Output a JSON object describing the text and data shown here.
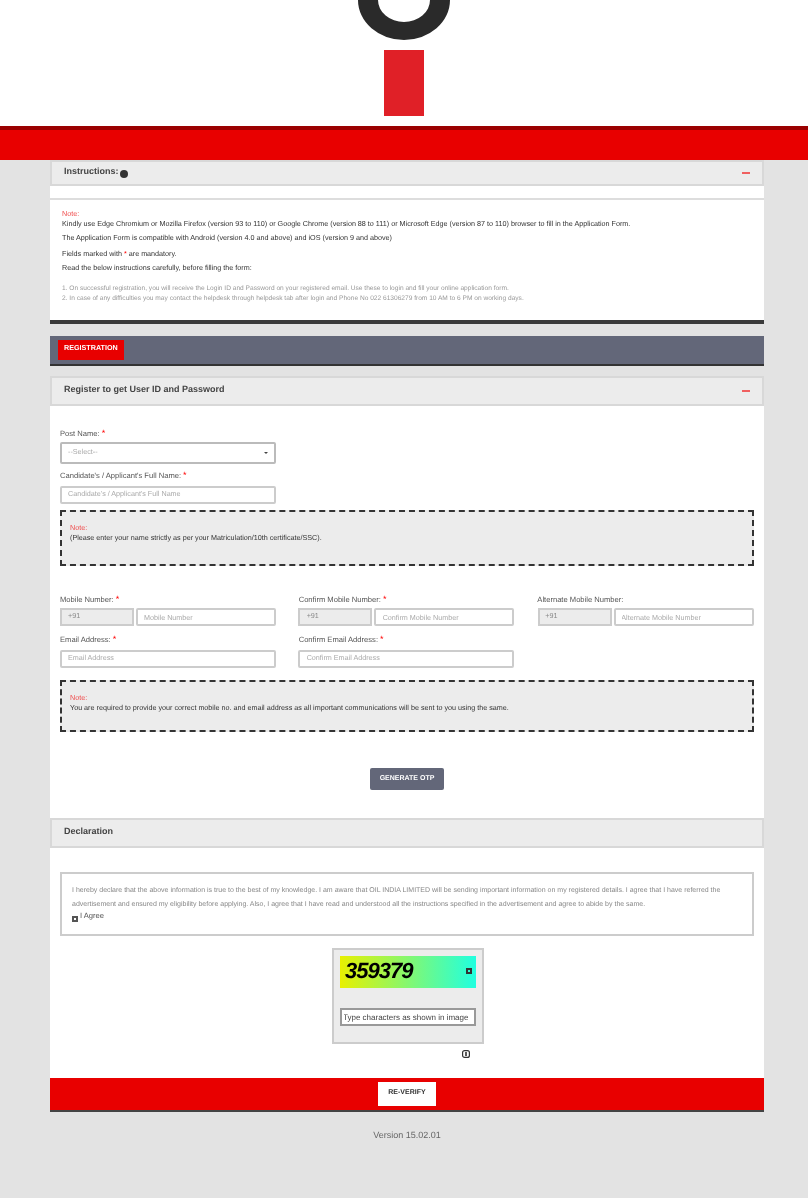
{
  "instructions": {
    "title": "Instructions:",
    "note_label": "Note:",
    "paragraphs": [
      {
        "text": "Kindly use Edge Chromium or Mozilla Firefox (version 93 to 110) or Google Chrome (version 88 to 111) or Microsoft Edge (version 87 to 110) browser to fill in the Application Form."
      },
      {
        "text": "The Application Form is compatible with Android (version 4.0 and above) and iOS (version 9 and above)"
      },
      {
        "text": "Fields marked with",
        "mark": "*",
        "after": "are mandatory."
      },
      {
        "text": "Read the below instructions carefully, before filling the form:"
      }
    ],
    "steps": [
      "1. On successful registration, you will receive the Login ID and Password on your registered email. Use these to login and fill your online application form.",
      "2. In case of any difficulties you may contact the helpdesk through helpdesk tab after login and Phone No 022 61306279 from 10 AM to 6 PM on working days."
    ]
  },
  "registration_button": "REGISTRATION",
  "register": {
    "title": "Register to get User ID and Password",
    "post_name": {
      "label": "Post Name:",
      "required": true,
      "placeholder": "--Select--"
    },
    "full_name": {
      "label": "Candidate's / Applicant's Full Name:",
      "required": true,
      "placeholder": "Candidate's / Applicant's Full Name"
    },
    "name_note": {
      "label": "Note:",
      "text": "(Please enter your name strictly as per your Matriculation/10th certificate/SSC)."
    },
    "mobile_fields": [
      {
        "label": "Mobile Number:",
        "required": true,
        "prefix": "+91",
        "placeholder": "Mobile Number"
      },
      {
        "label": "Confirm Mobile Number:",
        "required": true,
        "prefix": "+91",
        "placeholder": "Confirm Mobile Number"
      },
      {
        "label": "Alternate Mobile Number:",
        "required": false,
        "prefix": "+91",
        "placeholder": "Alternate Mobile Number"
      }
    ],
    "email_fields": [
      {
        "label": "Email Address:",
        "required": true,
        "placeholder": "Email Address"
      },
      {
        "label": "Confirm Email Address:",
        "required": true,
        "placeholder": "Confirm Email Address"
      }
    ],
    "contact_note": {
      "label": "Note:",
      "text": "You are required to provide your correct mobile no. and email address as all important communications will be sent to you using the same."
    },
    "otp_button": "GENERATE OTP"
  },
  "declaration": {
    "title": "Declaration",
    "text": "I hereby declare that the above information is true to the best of my knowledge. I am aware that OIL INDIA LIMITED will be sending important information on my registered details. I agree that I have referred the advertisement and ensured my eligibility before applying. Also, I agree that I have read and understood all the instructions specified in the advertisement and agree to abide by the same.",
    "agree_label": "I Agree",
    "checked": false
  },
  "captcha": {
    "code": "359379",
    "placeholder": "Type characters as shown in image"
  },
  "verify_button": "RE-VERIFY",
  "version": "Version 15.02.01"
}
